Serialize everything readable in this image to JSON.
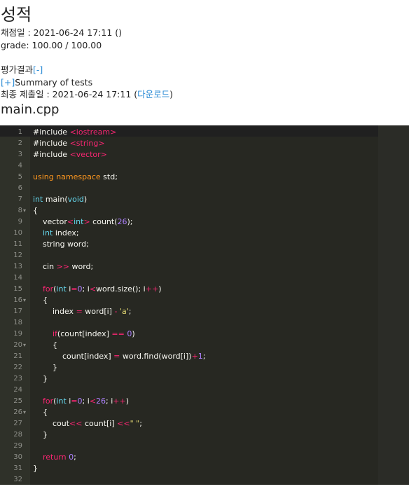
{
  "header": {
    "title": "성적",
    "graded_at": "채점일 : 2021-06-24 17:11 ()",
    "grade": "grade: 100.00 / 100.00",
    "eval_label": "평가결과",
    "eval_toggle": "[-]",
    "summary_toggle": "[+]",
    "summary_label": "Summary of tests",
    "final_submit": "최종 제출일 : 2021-06-24 17:11 (",
    "download": "다운로드",
    "final_submit_close": ")",
    "filename": "main.cpp"
  },
  "editor": {
    "lines": [
      {
        "n": "1",
        "fold": "",
        "html": "<span class='pre'>#include </span><span class='inc'>&lt;iostream&gt;</span>"
      },
      {
        "n": "2",
        "fold": "",
        "html": "<span class='pre'>#include </span><span class='inc'>&lt;string&gt;</span>"
      },
      {
        "n": "3",
        "fold": "",
        "html": "<span class='pre'>#include </span><span class='inc'>&lt;vector&gt;</span>"
      },
      {
        "n": "4",
        "fold": "",
        "html": ""
      },
      {
        "n": "5",
        "fold": "",
        "html": "<span class='orn'>using namespace</span> std;"
      },
      {
        "n": "6",
        "fold": "",
        "html": ""
      },
      {
        "n": "7",
        "fold": "",
        "html": "<span class='ty'>int</span> main(<span class='ty'>void</span>)"
      },
      {
        "n": "8",
        "fold": "▾",
        "html": "{"
      },
      {
        "n": "9",
        "fold": "",
        "html": "    vector<span class='kw'>&lt;</span><span class='ty'>int</span><span class='kw'>&gt;</span> count(<span class='nu'>26</span>);"
      },
      {
        "n": "10",
        "fold": "",
        "html": "    <span class='ty'>int</span> index;"
      },
      {
        "n": "11",
        "fold": "",
        "html": "    string word;"
      },
      {
        "n": "12",
        "fold": "",
        "html": ""
      },
      {
        "n": "13",
        "fold": "",
        "html": "    cin <span class='kw'>&gt;&gt;</span> word;"
      },
      {
        "n": "14",
        "fold": "",
        "html": ""
      },
      {
        "n": "15",
        "fold": "",
        "html": "    <span class='kw'>for</span>(<span class='ty'>int</span> i<span class='kw'>=</span><span class='nu'>0</span>; i<span class='kw'>&lt;</span>word.size(); i<span class='kw'>++</span>)"
      },
      {
        "n": "16",
        "fold": "▾",
        "html": "    {"
      },
      {
        "n": "17",
        "fold": "",
        "html": "        index <span class='kw'>=</span> word[i] <span class='kw'>-</span> <span class='st'>'a'</span>;"
      },
      {
        "n": "18",
        "fold": "",
        "html": ""
      },
      {
        "n": "19",
        "fold": "",
        "html": "        <span class='kw'>if</span>(count[index] <span class='kw'>==</span> <span class='nu'>0</span>)"
      },
      {
        "n": "20",
        "fold": "▾",
        "html": "        {"
      },
      {
        "n": "21",
        "fold": "",
        "html": "            count[index] <span class='kw'>=</span> word.find(word[i])<span class='kw'>+</span><span class='nu'>1</span>;"
      },
      {
        "n": "22",
        "fold": "",
        "html": "        }"
      },
      {
        "n": "23",
        "fold": "",
        "html": "    }"
      },
      {
        "n": "24",
        "fold": "",
        "html": ""
      },
      {
        "n": "25",
        "fold": "",
        "html": "    <span class='kw'>for</span>(<span class='ty'>int</span> i<span class='kw'>=</span><span class='nu'>0</span>; i<span class='kw'>&lt;</span><span class='nu'>26</span>; i<span class='kw'>++</span>)"
      },
      {
        "n": "26",
        "fold": "▾",
        "html": "    {"
      },
      {
        "n": "27",
        "fold": "",
        "html": "        cout<span class='kw'>&lt;&lt;</span> count[i] <span class='kw'>&lt;&lt;</span><span class='st'>\" \"</span>;"
      },
      {
        "n": "28",
        "fold": "",
        "html": "    }"
      },
      {
        "n": "29",
        "fold": "",
        "html": ""
      },
      {
        "n": "30",
        "fold": "",
        "html": "    <span class='kw'>return</span> <span class='nu'>0</span>;"
      },
      {
        "n": "31",
        "fold": "",
        "html": "}"
      },
      {
        "n": "32",
        "fold": "",
        "html": ""
      }
    ]
  }
}
